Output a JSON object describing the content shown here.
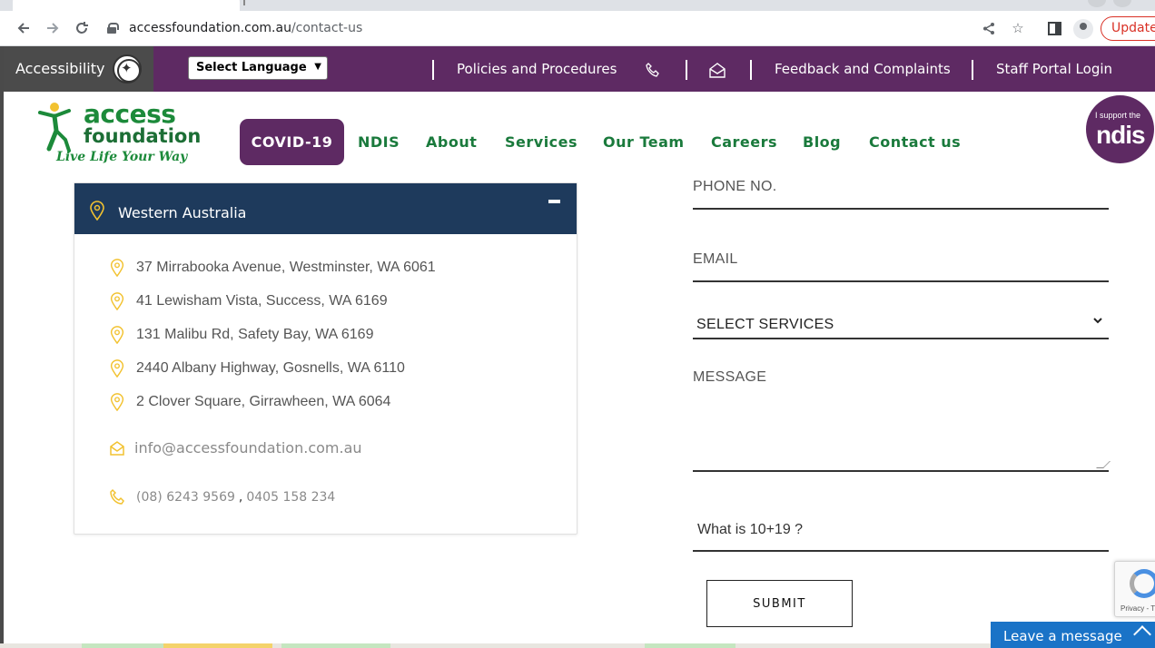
{
  "browser": {
    "url_domain": "accessfoundation.com.au",
    "url_path": "/contact-us",
    "update_label": "Update"
  },
  "topbar": {
    "accessibility_label": "Accessibility",
    "language_select": "Select Language",
    "policies_label": "Policies and Procedures",
    "feedback_label": "Feedback and Complaints",
    "staff_portal_label": "Staff Portal Login"
  },
  "logo": {
    "word1": "access",
    "word2": "foundation",
    "tagline": "Live Life Your Way"
  },
  "menu": {
    "covid": "COVID-19",
    "items": [
      "NDIS",
      "About",
      "Services",
      "Our Team",
      "Careers",
      "Blog",
      "Contact us"
    ]
  },
  "ndis_badge": {
    "small": "I support the",
    "big": "ndis"
  },
  "locations": {
    "region": "Western Australia",
    "addresses": [
      "37 Mirrabooka Avenue, Westminster, WA 6061",
      "41 Lewisham Vista, Success, WA 6169",
      "131 Malibu Rd, Safety Bay, WA 6169",
      "2440 Albany Highway, Gosnells, WA 6110",
      "2 Clover Square, Girrawheen, WA 6064"
    ],
    "email": "info@accessfoundation.com.au",
    "phone1": "(08) 6243 9569",
    "phone_separator": ",",
    "phone2": "0405 158 234"
  },
  "form": {
    "phone_placeholder": "PHONE NO.",
    "email_placeholder": "EMAIL",
    "services_select": "SELECT SERVICES",
    "message_placeholder": "MESSAGE",
    "captcha_question": "What is 10+19 ?",
    "submit_label": "SUBMIT"
  },
  "recaptcha_text": "Privacy - T",
  "chat": {
    "label": "Leave a message"
  },
  "colors": {
    "brand_purple": "#5e2a63",
    "brand_green": "#1a7a3c",
    "card_header": "#1e3a5c",
    "pin_yellow": "#f2c230"
  }
}
